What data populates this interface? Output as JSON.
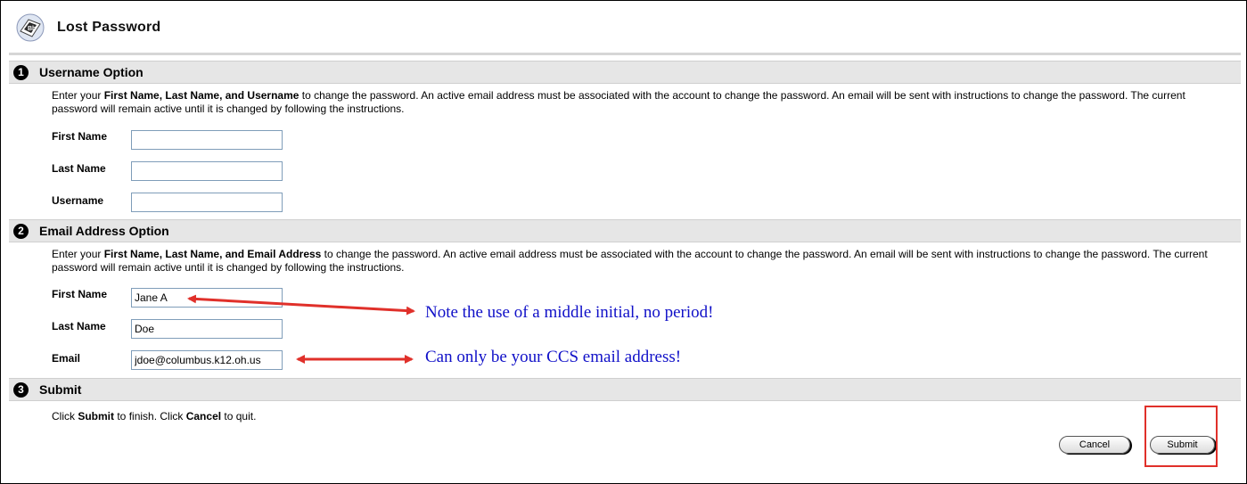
{
  "header": {
    "title": "Lost Password",
    "icon": "blackboard-book-icon"
  },
  "sections": {
    "username": {
      "number": "1",
      "title": "Username Option",
      "desc_pre": "Enter your ",
      "desc_bold": "First Name, Last Name, and Username",
      "desc_post": " to change the password. An active email address must be associated with the account to change the password. An email will be sent with instructions to change the password. The current password will remain active until it is changed by following the instructions.",
      "first_label": "First Name",
      "last_label": "Last Name",
      "user_label": "Username",
      "first_value": "",
      "last_value": "",
      "user_value": ""
    },
    "email": {
      "number": "2",
      "title": "Email Address Option",
      "desc_pre": "Enter your ",
      "desc_bold": "First Name, Last Name, and Email Address",
      "desc_post": " to change the password. An active email address must be associated with the account to change the password. An email will be sent with instructions to change the password. The current password will remain active until it is changed by following the instructions.",
      "first_label": "First Name",
      "last_label": "Last Name",
      "email_label": "Email",
      "first_value": "Jane A",
      "last_value": "Doe",
      "email_value": "jdoe@columbus.k12.oh.us"
    },
    "submit": {
      "number": "3",
      "title": "Submit",
      "text_1": "Click ",
      "text_b1": "Submit",
      "text_2": " to finish. Click ",
      "text_b2": "Cancel",
      "text_3": " to quit."
    }
  },
  "buttons": {
    "cancel": "Cancel",
    "submit": "Submit"
  },
  "annotations": {
    "note_initial": "Note the use of a middle initial, no period!",
    "note_email": "Can only be your CCS email address!",
    "arrow_color": "#e0302a",
    "note_color": "#1010c8"
  }
}
